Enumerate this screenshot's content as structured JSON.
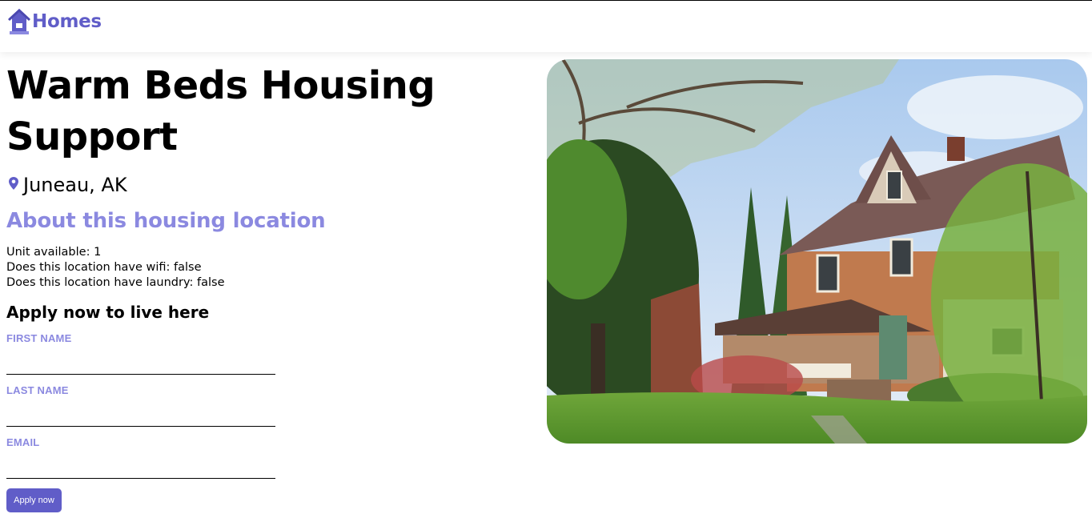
{
  "header": {
    "brand_label": "Homes",
    "brand_icon": "house-icon"
  },
  "listing": {
    "name": "Warm Beds Housing Support",
    "location": "Juneau, AK",
    "location_icon": "map-pin-icon",
    "photo_description": "house-photo"
  },
  "about": {
    "heading": "About this housing location",
    "units": "Unit available: 1",
    "wifi": "Does this location have wifi: false",
    "laundry": "Does this location have laundry: false"
  },
  "apply": {
    "heading": "Apply now to live here",
    "first_name_label": "FIRST NAME",
    "first_name_value": "",
    "last_name_label": "LAST NAME",
    "last_name_value": "",
    "email_label": "EMAIL",
    "email_value": "",
    "button_label": "Apply now"
  },
  "colors": {
    "accent": "#605DC8",
    "accent_light": "#8B89E0"
  }
}
